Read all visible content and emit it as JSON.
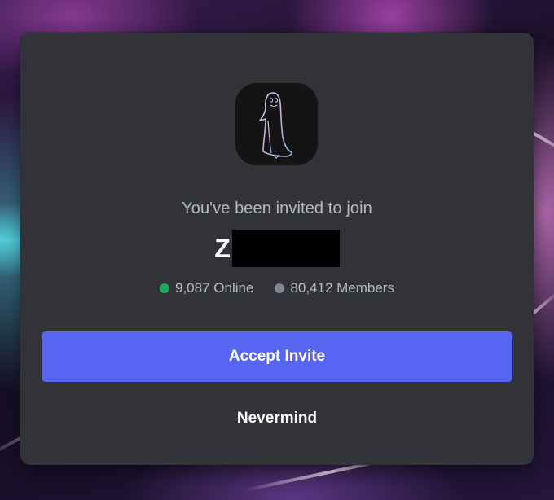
{
  "invite": {
    "heading": "You've been invited to join",
    "server_name_visible": "Z",
    "server_icon": "penguin-icon",
    "online_count_label": "9,087 Online",
    "member_count_label": "80,412 Members"
  },
  "buttons": {
    "accept_label": "Accept Invite",
    "nevermind_label": "Nevermind"
  },
  "colors": {
    "modal_background": "#313338",
    "accent": "#5865f2",
    "online_dot": "#23a55a",
    "members_dot": "#80848e",
    "muted_text": "#b5bac1"
  }
}
